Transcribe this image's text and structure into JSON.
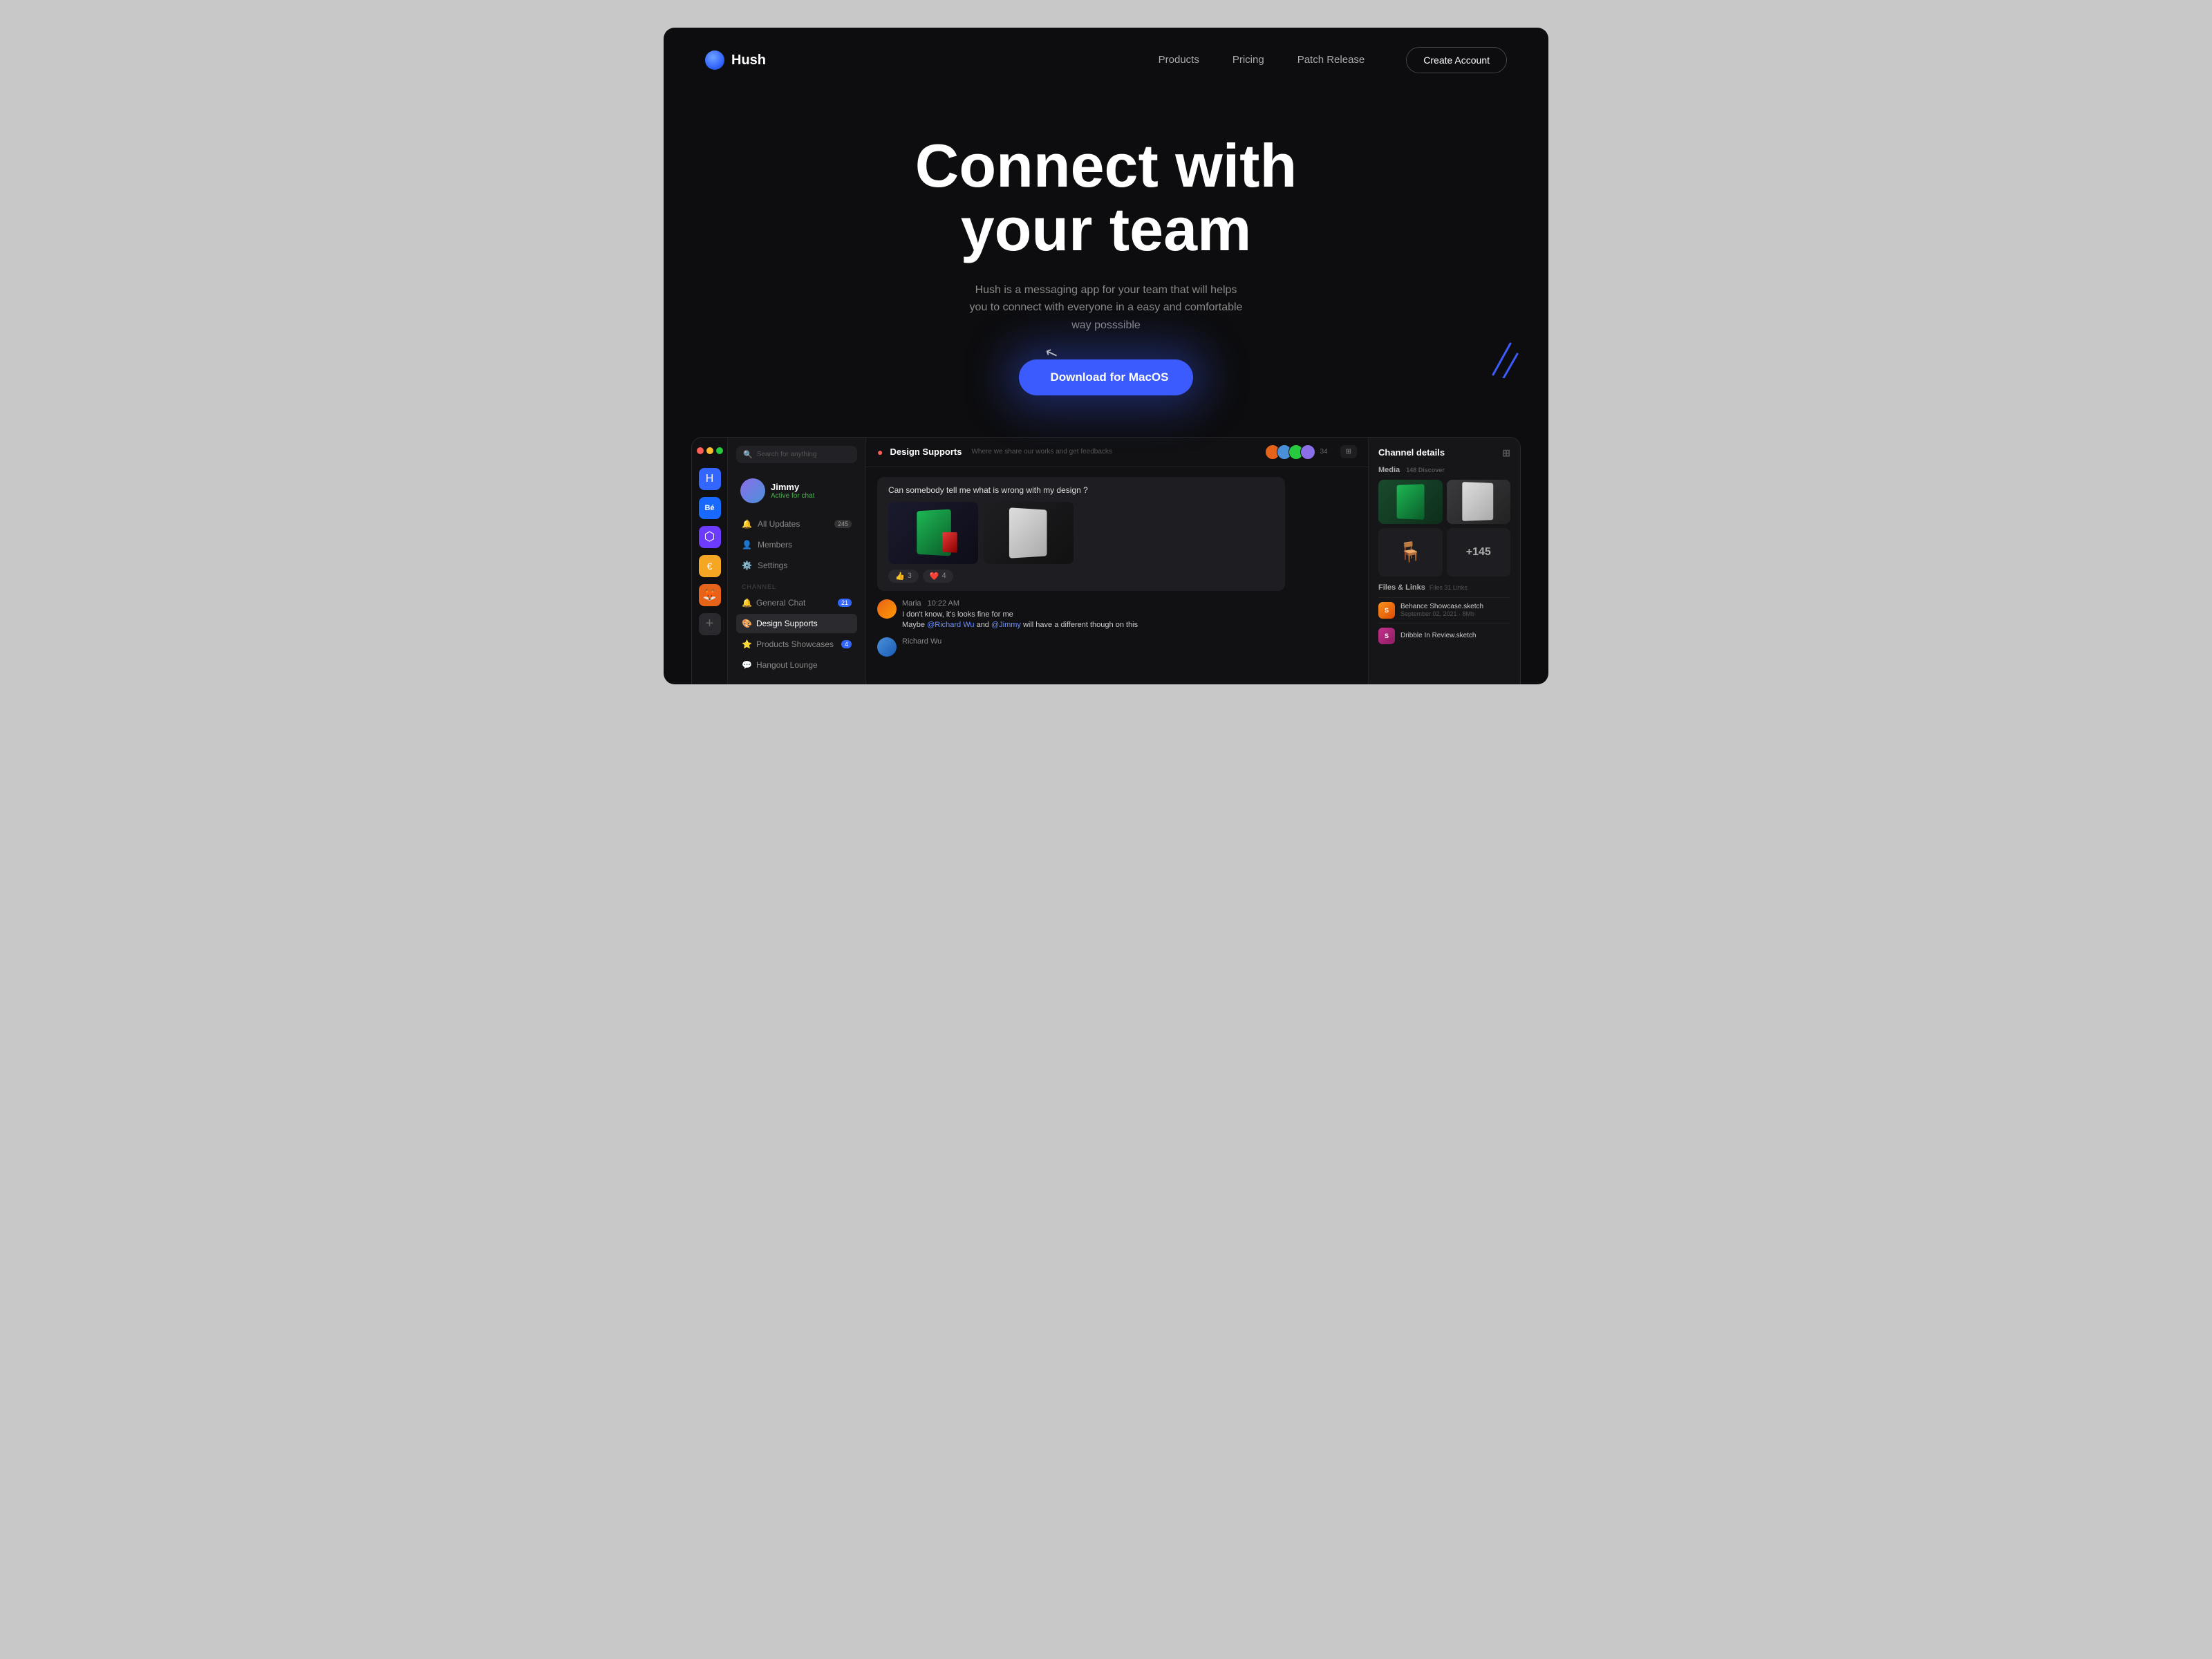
{
  "page": {
    "bg": "#0d0d0f"
  },
  "nav": {
    "logo_dot": "●",
    "logo_name": "Hush",
    "links": [
      "Products",
      "Pricing",
      "Patch Release"
    ],
    "cta": "Create Account"
  },
  "hero": {
    "title_line1": "Connect with",
    "title_line2": "your team",
    "subtitle": "Hush is a messaging app for your team that will helps you to connect with everyone in a easy and comfortable way posssible",
    "download_btn": "Download for MacOS"
  },
  "app": {
    "sidebar_icons": [
      {
        "name": "hush-icon",
        "label": "H",
        "class": "si-blue"
      },
      {
        "name": "behance-icon",
        "label": "Bé",
        "class": "si-behance"
      },
      {
        "name": "notion-icon",
        "label": "▲",
        "class": "si-purple"
      },
      {
        "name": "app-yellow",
        "label": "€",
        "class": "si-yellow"
      },
      {
        "name": "firefox-icon",
        "label": "🦊",
        "class": "si-firefox"
      }
    ],
    "search_placeholder": "Search for anything",
    "user": {
      "name": "Jimmy",
      "status": "Active for chat"
    },
    "menu_items": [
      {
        "label": "All Updates",
        "badge": "245"
      },
      {
        "label": "Members",
        "badge": ""
      },
      {
        "label": "Settings",
        "badge": ""
      }
    ],
    "section_label": "CHANNEL",
    "channels": [
      {
        "label": "General Chat",
        "badge": "21",
        "active": false
      },
      {
        "label": "Design Supports",
        "badge": "",
        "active": true
      },
      {
        "label": "Products Showcases",
        "badge": "4",
        "active": false
      },
      {
        "label": "Hangout Lounge",
        "badge": "",
        "active": false
      }
    ],
    "chat": {
      "channel_name": "Design Supports",
      "channel_desc": "Where we share our works and get feedbacks",
      "member_count": "34",
      "main_message": "Can somebody tell me what is wrong with my design ?",
      "reactions": [
        {
          "emoji": "👍",
          "count": "3"
        },
        {
          "emoji": "❤️",
          "count": "4"
        }
      ],
      "messages": [
        {
          "sender": "Maria",
          "time": "10:22 AM",
          "lines": [
            "I don't know, it's looks fine for me",
            "Maybe @Richard Wu and @Jimmy will have a different though on this"
          ]
        },
        {
          "sender": "Richard Wu",
          "time": "",
          "lines": []
        }
      ]
    },
    "right_panel": {
      "title": "Channel details",
      "media_label": "Media",
      "media_count": "148 Discover",
      "plus_count": "+145",
      "files_label": "Files & Links",
      "files_count": "Files 31 Links",
      "files": [
        {
          "name": "Behance Showcase.sketch",
          "meta": "September 02, 2021 · 8Mb",
          "type": "sketch"
        },
        {
          "name": "Dribble In Review.sketch",
          "meta": "",
          "type": "sketch2"
        }
      ]
    }
  }
}
